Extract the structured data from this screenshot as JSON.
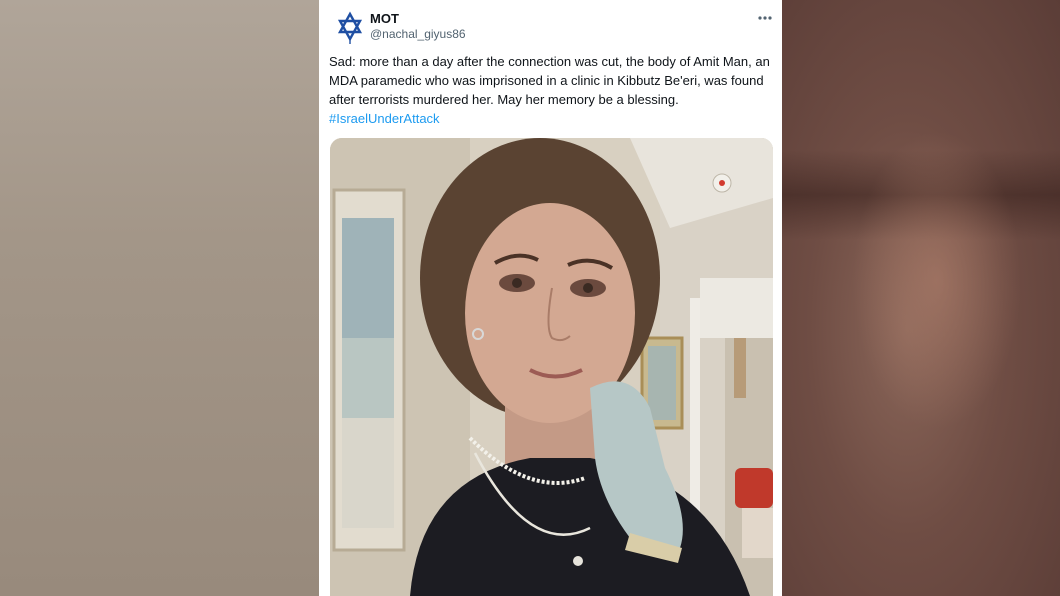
{
  "tweet": {
    "display_name": "MOT",
    "handle": "@nachal_giyus86",
    "more_icon": "more-horizontal-icon",
    "text": "Sad: more than a day after the connection was cut, the body of Amit Man, an MDA paramedic who was imprisoned in a clinic in Kibbutz Be'eri, was found after terrorists murdered her. May her memory be a blessing.",
    "hashtag": "#IsraelUnderAttack",
    "avatar_icon": "star-of-david-icon",
    "accent_color": "#1d9bf0"
  }
}
